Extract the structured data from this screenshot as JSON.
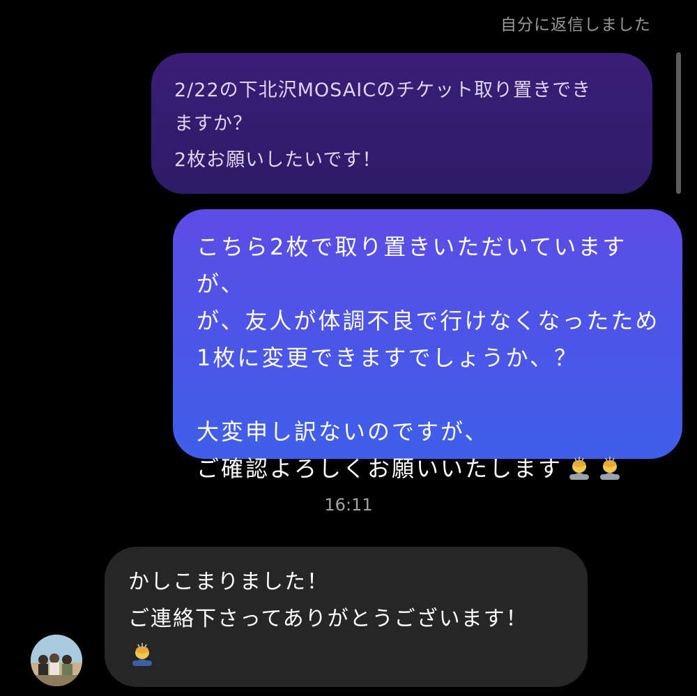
{
  "thread": {
    "reply_label": "自分に返信しました",
    "quoted_message": {
      "lines": [
        "2/22の下北沢MOSAICのチケット取り置きでき",
        "ますか？",
        "2枚お願いしたいです！"
      ]
    },
    "sent_message": {
      "lines": [
        "こちら2枚で取り置きいただいていますが、",
        "が、友人が体調不良で行けなくなったため",
        "1枚に変更できますでしょうか、？",
        "大変申し訳ないのですが、",
        "ご確認よろしくお願いいたします"
      ],
      "emoji": "bowing-person-emoji",
      "emoji_count": 2
    },
    "timestamp": "16:11",
    "received_message": {
      "lines": [
        "かしこまりました！",
        "ご連絡下さってありがとうございます！"
      ],
      "emoji": "bowing-person-emoji"
    }
  },
  "colors": {
    "background": "#000000",
    "quoted_bubble": "#331c6e",
    "sent_bubble_top": "#5d4ce6",
    "sent_bubble_bottom": "#3f5fe9",
    "received_bubble": "#262626",
    "muted_text": "#9a9a9a"
  }
}
